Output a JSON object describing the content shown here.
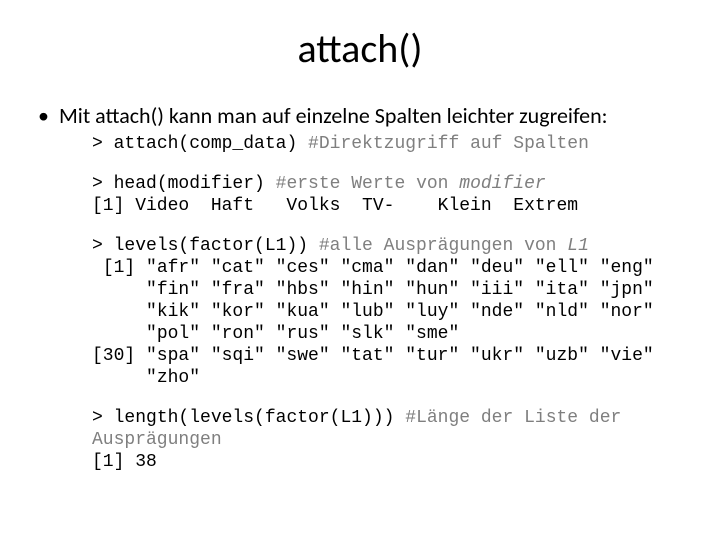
{
  "title": "attach()",
  "bullet": "Mit attach() kann man auf einzelne Spalten leichter zugreifen:",
  "block1": {
    "prompt": "> ",
    "cmd": "attach(comp_data) ",
    "comment": "#Direktzugriff auf Spalten"
  },
  "block2": {
    "l1_prompt": "> ",
    "l1_cmd": "head(modifier) ",
    "l1_comment_pre": "#erste Werte von ",
    "l1_comment_i": "modifier",
    "l2": "[1] Video  Haft   Volks  TV-    Klein  Extrem"
  },
  "block3": {
    "l1_prompt": "> ",
    "l1_cmd": "levels(factor(L1)) ",
    "l1_comment_pre": "#alle Ausprägungen von ",
    "l1_comment_i": "L1",
    "l2": " [1] \"afr\" \"cat\" \"ces\" \"cma\" \"dan\" \"deu\" \"ell\" \"eng\"",
    "l3": "     \"fin\" \"fra\" \"hbs\" \"hin\" \"hun\" \"iii\" \"ita\" \"jpn\"",
    "l4": "     \"kik\" \"kor\" \"kua\" \"lub\" \"luy\" \"nde\" \"nld\" \"nor\"",
    "l5": "     \"pol\" \"ron\" \"rus\" \"slk\" \"sme\"",
    "l6": "[30] \"spa\" \"sqi\" \"swe\" \"tat\" \"tur\" \"ukr\" \"uzb\" \"vie\"",
    "l7": "     \"zho\""
  },
  "block4": {
    "l1_prompt": "> ",
    "l1_cmd": "length(levels(factor(L1))) ",
    "l1_comment": "#Länge der Liste der Ausprägungen",
    "l2": "[1] 38"
  }
}
